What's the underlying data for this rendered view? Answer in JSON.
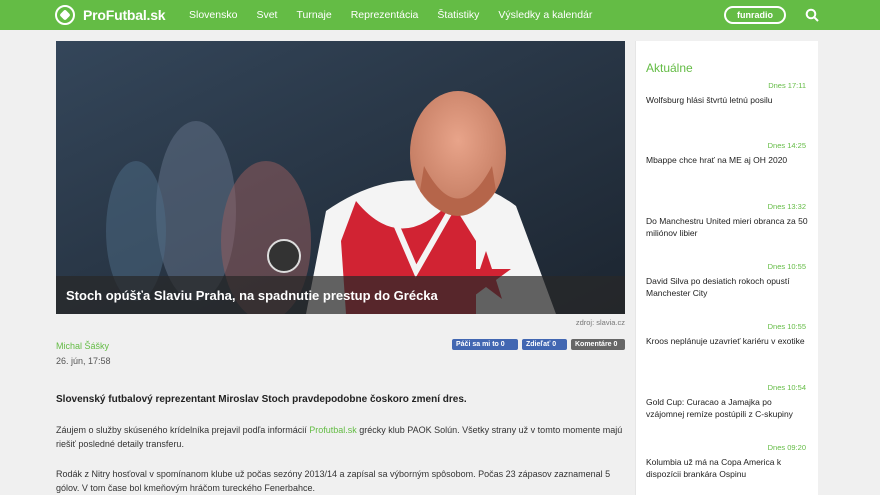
{
  "header": {
    "logo_text": "ProFutbal.sk",
    "nav": [
      "Slovensko",
      "Svet",
      "Turnaje",
      "Reprezentácia",
      "Štatistiky",
      "Výsledky a kalendár"
    ],
    "partner_logo": "funradio"
  },
  "article": {
    "hero_caption": "Stoch opúšťa Slaviu Praha, na spadnutie prestup do Grécka",
    "photo_source": "zdroj: slavia.cz",
    "author": "Michal Šášky",
    "date": "26. jún, 17:58",
    "social": {
      "like": "Páči sa mi to 0",
      "share": "Zdieľať 0",
      "comments": "Komentáre 0"
    },
    "lead": "Slovenský futbalový reprezentant Miroslav Stoch pravdepodobne čoskoro zmení dres.",
    "p1_a": "Záujem o služby skúseného krídelníka prejavil podľa informácií ",
    "p1_link": "Profutbal.sk",
    "p1_b": " grécky klub PAOK Solún. Všetky strany už v tomto momente majú riešiť posledné detaily transferu.",
    "p2": "Rodák z Nitry hosťoval v spomínanom klube už počas sezóny 2013/14 a zapísal sa výborným spôsobom. Počas 23 zápasov zaznamenal 5 gólov. V tom čase bol kmeňovým hráčom tureckého Fenerbahce."
  },
  "sidebar": {
    "title": "Aktuálne",
    "items": [
      {
        "time": "Dnes 17:11",
        "title": "Wolfsburg hlási štvrtú letnú posilu"
      },
      {
        "time": "Dnes 14:25",
        "title": "Mbappe chce hrať na ME aj OH 2020"
      },
      {
        "time": "Dnes 13:32",
        "title": "Do Manchestru United mieri obranca za 50 miliónov libier"
      },
      {
        "time": "Dnes 10:55",
        "title": "David Silva po desiatich rokoch opustí Manchester City"
      },
      {
        "time": "Dnes 10:55",
        "title": "Kroos neplánuje uzavrieť kariéru v exotike"
      },
      {
        "time": "Dnes 10:54",
        "title": "Gold Cup: Curacao a Jamajka po vzájomnej remíze postúpili z C-skupiny"
      },
      {
        "time": "Dnes 09:20",
        "title": "Kolumbia už má na Copa America k dispozícii brankára Ospinu"
      }
    ]
  }
}
